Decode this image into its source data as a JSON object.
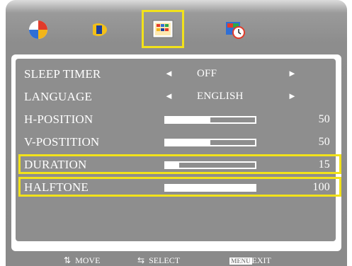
{
  "tabs": [
    {
      "icon": "color-picture-icon"
    },
    {
      "icon": "audio-icon"
    },
    {
      "icon": "osd-setting-icon"
    },
    {
      "icon": "timer-setting-icon"
    }
  ],
  "menu": {
    "sleep_timer": {
      "label": "SLEEP TIMER",
      "value": "OFF",
      "left_arrow": "◄",
      "right_arrow": "►"
    },
    "language": {
      "label": "LANGUAGE",
      "value": "ENGLISH",
      "left_arrow": "◄",
      "right_arrow": "►"
    },
    "h_position": {
      "label": "H-POSITION",
      "value": "50",
      "level": 0.5
    },
    "v_position": {
      "label": "V-POSTITION",
      "value": "50",
      "level": 0.5
    },
    "duration": {
      "label": "DURATION",
      "value": "15",
      "level": 0.15
    },
    "halftone": {
      "label": "HALFTONE",
      "value": "100",
      "level": 1.0
    }
  },
  "footer": {
    "move": "MOVE",
    "select": "SELECT",
    "exit_box": "MENU",
    "exit": "EXIT"
  },
  "colors": {
    "highlight": "#f2e21a",
    "panel": "#8e8e8e"
  }
}
